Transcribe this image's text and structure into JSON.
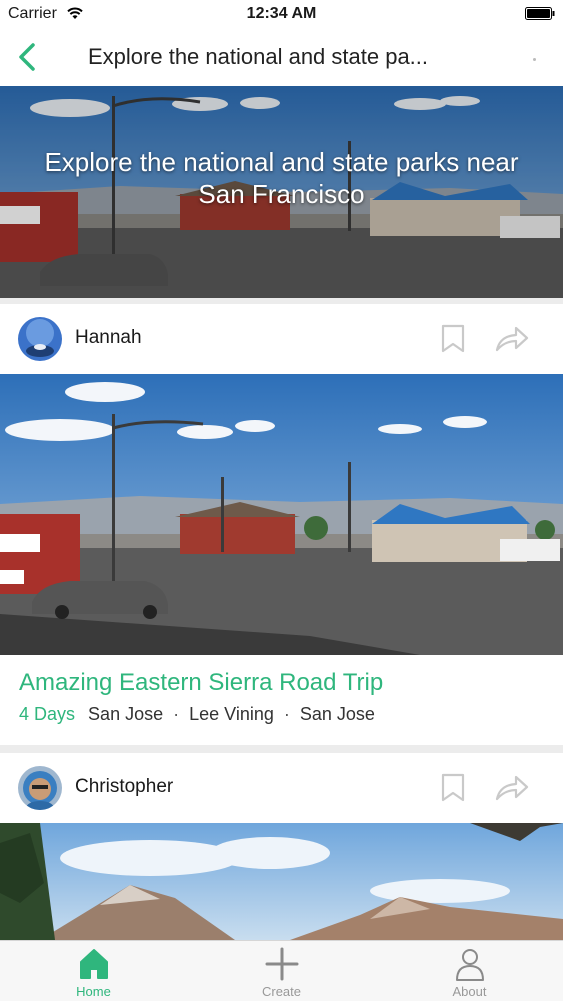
{
  "status_bar": {
    "carrier": "Carrier",
    "time": "12:34 AM"
  },
  "nav": {
    "title": "Explore the national and state pa..."
  },
  "hero": {
    "title": "Explore the national and state parks near San Francisco"
  },
  "cards": [
    {
      "author": "Hannah",
      "title": "Amazing Eastern Sierra Road Trip",
      "days": "4 Days",
      "stops": [
        "San Jose",
        "Lee Vining",
        "San Jose"
      ]
    },
    {
      "author": "Christopher"
    }
  ],
  "tabs": [
    {
      "label": "Home",
      "icon": "home-icon",
      "active": true
    },
    {
      "label": "Create",
      "icon": "plus-icon",
      "active": false
    },
    {
      "label": "About",
      "icon": "person-icon",
      "active": false
    }
  ],
  "colors": {
    "accent": "#2fb67d",
    "sky": "#4d86c6",
    "road": "#5b5b5b"
  }
}
